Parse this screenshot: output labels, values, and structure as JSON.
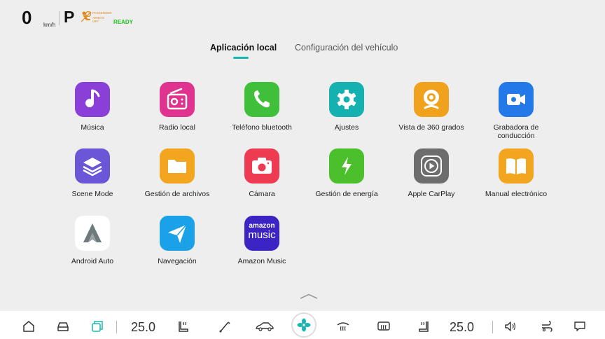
{
  "status": {
    "speed": "0",
    "speed_unit": "km/h",
    "gear": "P",
    "airbag_line1": "PASSENGER",
    "airbag_line2": "AIRBAG OFF",
    "ready": "READY"
  },
  "tabs": [
    {
      "label": "Aplicación local",
      "active": true
    },
    {
      "label": "Configuración del vehículo",
      "active": false
    }
  ],
  "apps": [
    {
      "label": "Música",
      "icon": "music-note-icon",
      "color": "#8a3fd8"
    },
    {
      "label": "Radio local",
      "icon": "radio-icon",
      "color": "#e0338f"
    },
    {
      "label": "Teléfono bluetooth",
      "icon": "phone-icon",
      "color": "#3fbf3a"
    },
    {
      "label": "Ajustes",
      "icon": "gear-icon",
      "color": "#14b1b0"
    },
    {
      "label": "Vista de 360 grados",
      "icon": "camera-360-icon",
      "color": "#f1a21d"
    },
    {
      "label": "Grabadora de conducción",
      "icon": "video-camera-icon",
      "color": "#2479e8"
    },
    {
      "label": "Scene Mode",
      "icon": "layers-icon",
      "color": "#6a56d6"
    },
    {
      "label": "Gestión de archivos",
      "icon": "folder-icon",
      "color": "#f2a51e"
    },
    {
      "label": "Cámara",
      "icon": "camera-icon",
      "color": "#ef3b52"
    },
    {
      "label": "Gestión de energía",
      "icon": "lightning-icon",
      "color": "#4cbf2c"
    },
    {
      "label": "Apple CarPlay",
      "icon": "carplay-icon",
      "color": "#6d6d6d"
    },
    {
      "label": "Manual electrónico",
      "icon": "book-icon",
      "color": "#f2a51e"
    },
    {
      "label": "Android Auto",
      "icon": "android-auto-icon",
      "color": "#ffffff"
    },
    {
      "label": "Navegación",
      "icon": "navigation-arrow-icon",
      "color": "#1aa1e8"
    },
    {
      "label": "Amazon Music",
      "icon": "amazon-music-icon",
      "color": "#3b23c4",
      "icon_text_1": "amazon",
      "icon_text_2": "music"
    }
  ],
  "bottom_bar": {
    "left_temp": "25.0",
    "right_temp": "25.0",
    "icons": [
      "home-icon",
      "car-front-icon",
      "multitask-icon",
      "seat-heat-icon",
      "wiper-icon",
      "car-side-icon",
      "fan-icon",
      "rear-defrost-icon",
      "front-defrost-icon",
      "seat-heat-right-icon",
      "volume-icon",
      "air-flow-icon",
      "chat-icon"
    ],
    "accent": "#1bb5b0"
  }
}
